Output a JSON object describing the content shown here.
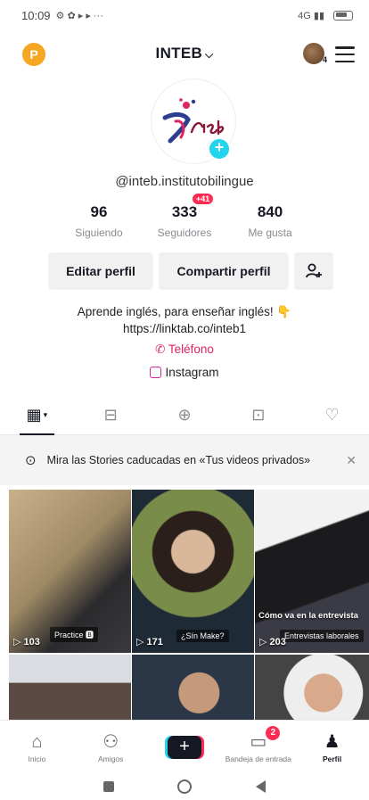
{
  "status_bar": {
    "time": "10:09",
    "icons": "⚙ ✿ ▸ ▸ ···",
    "signal": "4G ▮▮"
  },
  "header": {
    "account_initial": "P",
    "account_name": "INTEB",
    "avatar_count": "4"
  },
  "profile": {
    "username": "@inteb.institutobilingue",
    "stats": [
      {
        "value": "96",
        "label": "Siguiendo"
      },
      {
        "value": "333",
        "label": "Seguidores",
        "badge": "+41"
      },
      {
        "value": "840",
        "label": "Me gusta"
      }
    ],
    "edit_label": "Editar perfil",
    "share_label": "Compartir perfil",
    "bio_line1": "Aprende inglés, para enseñar inglés! 👇",
    "bio_line2": "https://linktab.co/inteb1",
    "phone_label": "Teléfono",
    "instagram_label": "Instagram"
  },
  "stories_banner": {
    "text": "Mira las Stories caducadas en «Tus videos privados»"
  },
  "videos": [
    {
      "caption": "",
      "tag": "Practice 🅱",
      "plays": "103"
    },
    {
      "caption": "",
      "tag": "¿Sín Make?",
      "plays": "171"
    },
    {
      "caption": "Cómo va en la entrevista",
      "tag": "Entrevistas laborales",
      "plays": "203"
    }
  ],
  "bottom_nav": {
    "home": "Inicio",
    "friends": "Amigos",
    "inbox": "Bandeja de entrada",
    "inbox_badge": "2",
    "profile": "Perfil"
  },
  "colors": {
    "accent_red": "#fe2c55",
    "accent_cyan": "#20d5ec",
    "badge_orange": "#f5a623"
  }
}
